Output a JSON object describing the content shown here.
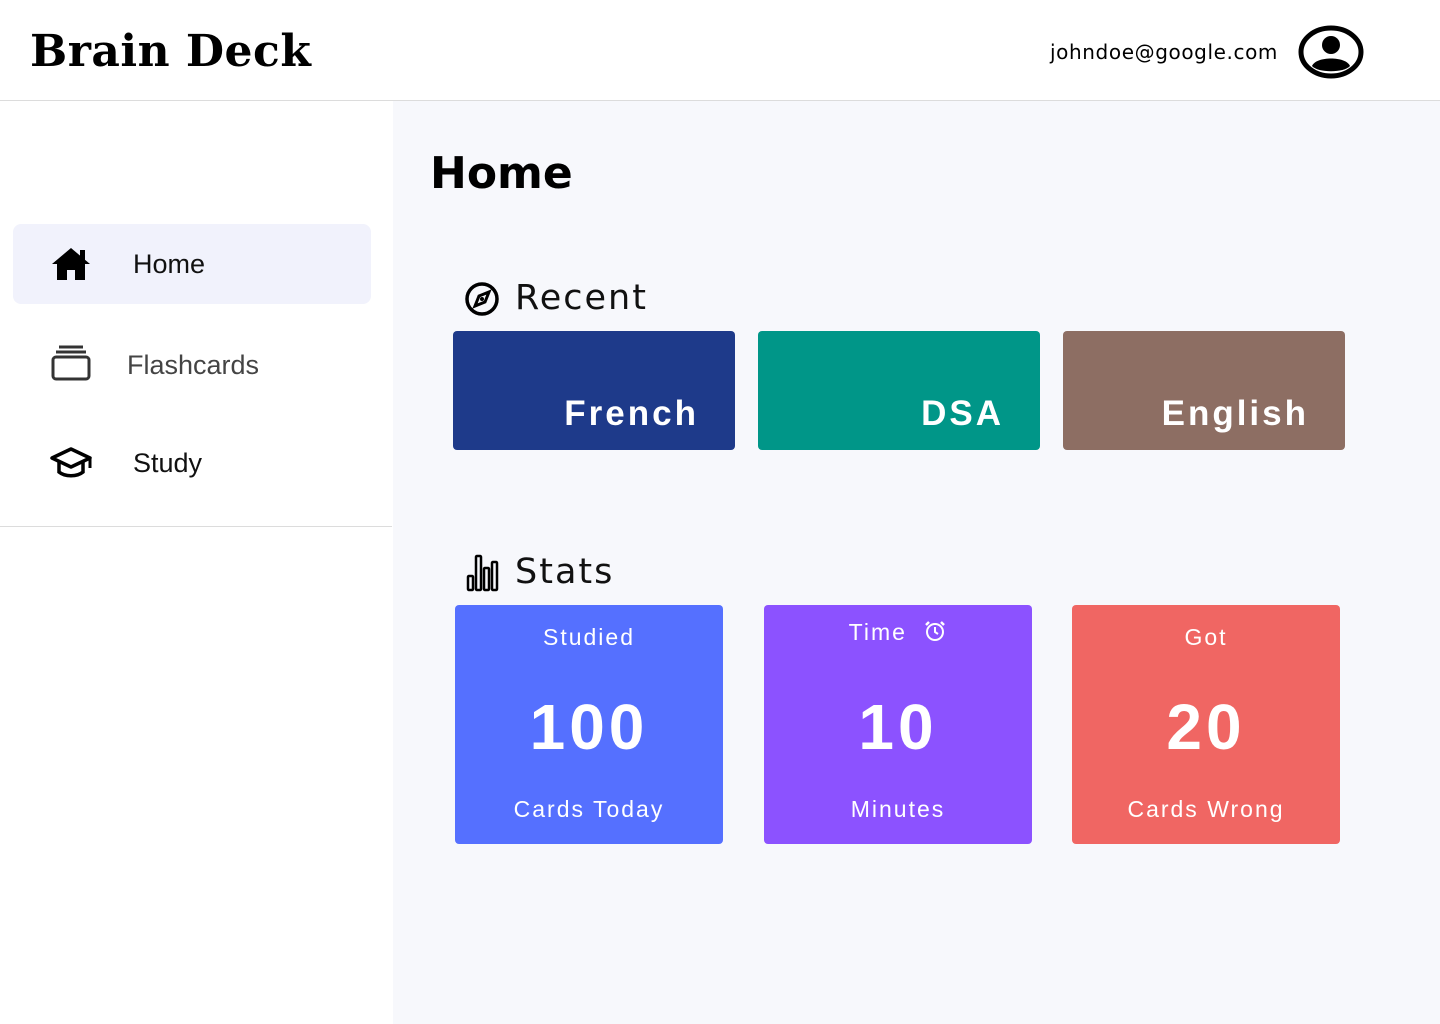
{
  "app": {
    "brand": "Brain Deck",
    "user_email": "johndoe@google.com"
  },
  "sidebar": {
    "items": [
      {
        "label": "Home",
        "icon": "home-icon",
        "active": true
      },
      {
        "label": "Flashcards",
        "icon": "cards-stack-icon",
        "active": false
      },
      {
        "label": "Study",
        "icon": "graduation-cap-icon",
        "active": false
      }
    ]
  },
  "main": {
    "title": "Home",
    "recent": {
      "label": "Recent",
      "icon": "compass-icon",
      "decks": [
        {
          "name": "French",
          "color": "#1e3a8a"
        },
        {
          "name": "DSA",
          "color": "#009688"
        },
        {
          "name": "English",
          "color": "#8d6e63"
        }
      ]
    },
    "stats": {
      "label": "Stats",
      "icon": "bar-chart-icon",
      "cards": [
        {
          "top": "Studied",
          "value": "100",
          "bottom": "Cards Today",
          "color": "#5570ff"
        },
        {
          "top": "Time",
          "top_icon": "alarm-clock-icon",
          "value": "10",
          "bottom": "Minutes",
          "color": "#8c52ff"
        },
        {
          "top": "Got",
          "value": "20",
          "bottom": "Cards Wrong",
          "color": "#f06663"
        }
      ]
    }
  }
}
